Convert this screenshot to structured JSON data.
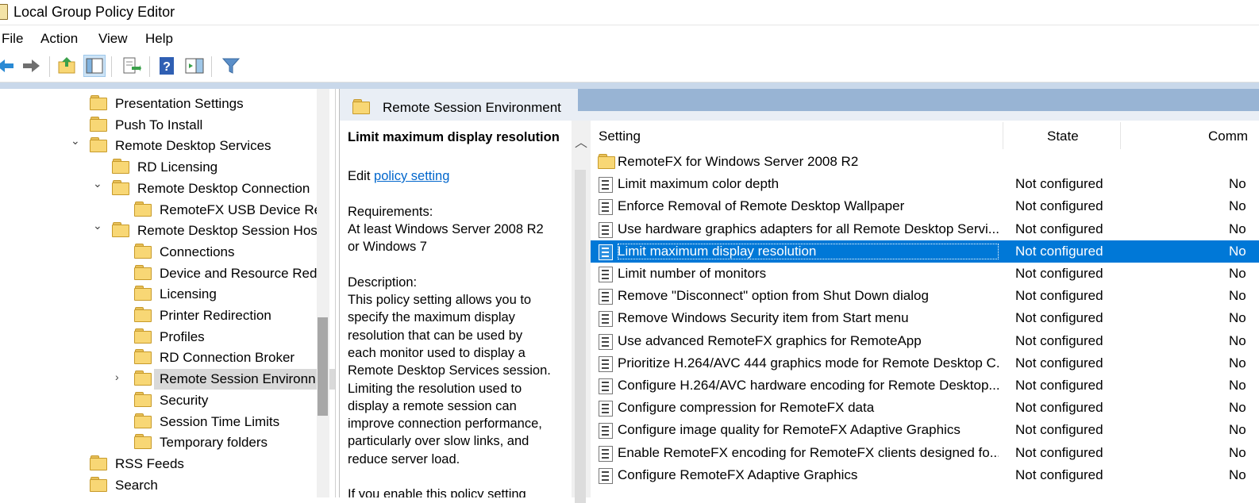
{
  "window": {
    "title": "Local Group Policy Editor"
  },
  "menu": [
    "File",
    "Action",
    "View",
    "Help"
  ],
  "toolbar": {
    "icons": [
      "back-icon",
      "forward-icon",
      "up-folder-icon",
      "show-hide-tree-icon",
      "export-list-icon",
      "help-icon",
      "show-hide-action-pane-icon",
      "filter-icon"
    ]
  },
  "tree": {
    "items": [
      {
        "label": "Presentation Settings"
      },
      {
        "label": "Push To Install"
      },
      {
        "label": "Remote Desktop Services"
      },
      {
        "label": "RD Licensing"
      },
      {
        "label": "Remote Desktop Connection"
      },
      {
        "label": "RemoteFX USB Device Re"
      },
      {
        "label": "Remote Desktop Session Hos"
      },
      {
        "label": "Connections"
      },
      {
        "label": "Device and Resource Red"
      },
      {
        "label": "Licensing"
      },
      {
        "label": "Printer Redirection"
      },
      {
        "label": "Profiles"
      },
      {
        "label": "RD Connection Broker"
      },
      {
        "label": "Remote Session Environn"
      },
      {
        "label": "Security"
      },
      {
        "label": "Session Time Limits"
      },
      {
        "label": "Temporary folders"
      },
      {
        "label": "RSS Feeds"
      },
      {
        "label": "Search"
      }
    ]
  },
  "pane": {
    "title": "Remote Session Environment",
    "description": {
      "heading": "Limit maximum display resolution",
      "edit_prefix": "Edit",
      "edit_link": "policy setting ",
      "requirements_label": "Requirements:",
      "requirements_lines": [
        "At least Windows Server 2008 R2",
        "or Windows 7"
      ],
      "description_label": "Description:",
      "description_lines": [
        "This policy setting allows you to",
        "specify the maximum display",
        "resolution that can be used by",
        "each monitor used to display a",
        "Remote Desktop Services session.",
        "Limiting the resolution used to",
        "display a remote session can",
        "improve connection performance,",
        "particularly over slow links, and",
        "reduce server load."
      ],
      "trailing_line": "If you enable this policy setting"
    },
    "columns": {
      "setting": "Setting",
      "state": "State",
      "comment": "Comm"
    },
    "rows": [
      {
        "name": "RemoteFX for Windows Server 2008 R2",
        "state": "",
        "comment": ""
      },
      {
        "name": "Limit maximum color depth",
        "state": "Not configured",
        "comment": "No"
      },
      {
        "name": "Enforce Removal of Remote Desktop Wallpaper",
        "state": "Not configured",
        "comment": "No"
      },
      {
        "name": "Use hardware graphics adapters for all Remote Desktop Servi...",
        "state": "Not configured",
        "comment": "No"
      },
      {
        "name": "Limit maximum display resolution",
        "state": "Not configured",
        "comment": "No"
      },
      {
        "name": "Limit number of monitors",
        "state": "Not configured",
        "comment": "No"
      },
      {
        "name": "Remove \"Disconnect\" option from Shut Down dialog",
        "state": "Not configured",
        "comment": "No"
      },
      {
        "name": "Remove Windows Security item from Start menu",
        "state": "Not configured",
        "comment": "No"
      },
      {
        "name": "Use advanced RemoteFX graphics for RemoteApp",
        "state": "Not configured",
        "comment": "No"
      },
      {
        "name": "Prioritize H.264/AVC 444 graphics mode for Remote Desktop C...",
        "state": "Not configured",
        "comment": "No"
      },
      {
        "name": "Configure H.264/AVC hardware encoding for Remote Desktop...",
        "state": "Not configured",
        "comment": "No"
      },
      {
        "name": "Configure compression for RemoteFX data",
        "state": "Not configured",
        "comment": "No"
      },
      {
        "name": "Configure image quality for RemoteFX Adaptive Graphics",
        "state": "Not configured",
        "comment": "No"
      },
      {
        "name": "Enable RemoteFX encoding for RemoteFX clients designed fo...",
        "state": "Not configured",
        "comment": "No"
      },
      {
        "name": "Configure RemoteFX Adaptive Graphics",
        "state": "Not configured",
        "comment": "No"
      }
    ]
  },
  "colors": {
    "selection": "#0078d7",
    "header_blue": "#98b4d4",
    "link": "#0066cc"
  }
}
